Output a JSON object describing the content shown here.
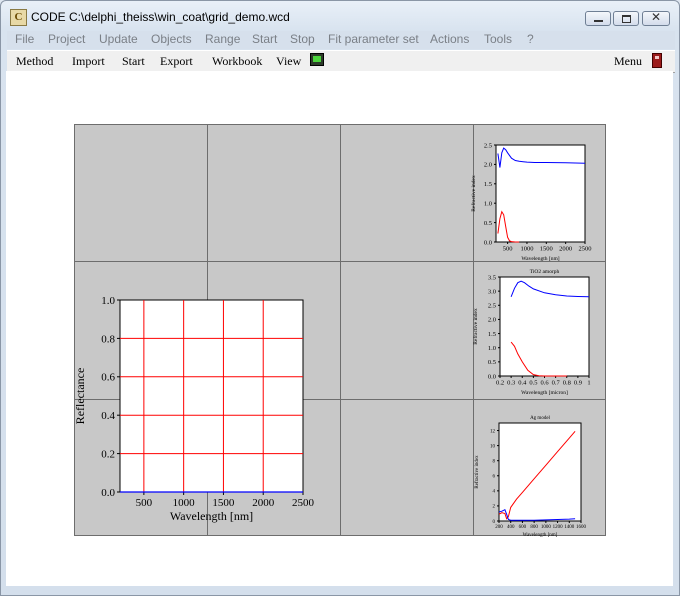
{
  "window": {
    "title": "CODE C:\\delphi_theiss\\win_coat\\grid_demo.wcd"
  },
  "menubar": [
    "File",
    "Project",
    "Update",
    "Objects",
    "Range",
    "Start",
    "Stop",
    "Fit parameter set",
    "Actions",
    "Tools",
    "?"
  ],
  "toolbar": {
    "items": [
      "Method",
      "Import",
      "Start",
      "Export",
      "Workbook",
      "View"
    ],
    "menu_label": "Menu"
  },
  "colors": {
    "blue_series": "#0000ff",
    "red_series": "#ff0000",
    "grid_bg": "#c8c8c8"
  },
  "chart_data": [
    {
      "type": "line",
      "title": "",
      "xlabel": "Wavelength [nm]",
      "ylabel": "Refractive index",
      "xlim": [
        200,
        2500
      ],
      "ylim": [
        0,
        2.5
      ],
      "xticks": [
        500,
        1000,
        1500,
        2000,
        2500
      ],
      "yticks": [
        0.0,
        0.5,
        1.0,
        1.5,
        2.0,
        2.5
      ],
      "series": [
        {
          "color": "blue",
          "x": [
            250,
            300,
            350,
            400,
            450,
            500,
            600,
            700,
            800,
            900,
            1000,
            1200,
            1500,
            2000,
            2500
          ],
          "y": [
            2.28,
            1.92,
            2.3,
            2.42,
            2.38,
            2.3,
            2.16,
            2.1,
            2.08,
            2.07,
            2.06,
            2.05,
            2.05,
            2.04,
            2.03
          ]
        },
        {
          "color": "red",
          "x": [
            250,
            300,
            350,
            400,
            450,
            500,
            550,
            600,
            700,
            800
          ],
          "y": [
            0.22,
            0.6,
            0.78,
            0.7,
            0.4,
            0.12,
            0.03,
            0.01,
            0.0,
            0.0
          ]
        }
      ]
    },
    {
      "type": "line",
      "title": "TiO2 amorph",
      "xlabel": "Wavelength [micron]",
      "ylabel": "Refractive index",
      "xlim": [
        0.2,
        1.0
      ],
      "ylim": [
        0,
        3.5
      ],
      "xticks": [
        0.2,
        0.3,
        0.4,
        0.5,
        0.6,
        0.7,
        0.8,
        0.9,
        1.0
      ],
      "yticks": [
        0.0,
        0.5,
        1.0,
        1.5,
        2.0,
        2.5,
        3.0,
        3.5
      ],
      "series": [
        {
          "color": "blue",
          "x": [
            0.3,
            0.33,
            0.36,
            0.39,
            0.42,
            0.46,
            0.5,
            0.6,
            0.7,
            0.8,
            0.9,
            1.0
          ],
          "y": [
            2.8,
            3.1,
            3.3,
            3.35,
            3.3,
            3.18,
            3.08,
            2.94,
            2.87,
            2.83,
            2.81,
            2.8
          ]
        },
        {
          "color": "red",
          "x": [
            0.3,
            0.33,
            0.36,
            0.4,
            0.45,
            0.5,
            0.55,
            0.6,
            0.7,
            0.8
          ],
          "y": [
            1.2,
            1.05,
            0.78,
            0.5,
            0.2,
            0.05,
            0.01,
            0.0,
            0.0,
            0.0
          ]
        }
      ]
    },
    {
      "type": "line",
      "title": "Ag model",
      "xlabel": "Wavelength [nm]",
      "ylabel": "Refractive index",
      "xlim": [
        200,
        1600
      ],
      "ylim": [
        0,
        13
      ],
      "xticks": [
        200,
        400,
        600,
        800,
        1000,
        1200,
        1400,
        1600
      ],
      "yticks": [
        0,
        2,
        4,
        6,
        8,
        10,
        12
      ],
      "series": [
        {
          "color": "red",
          "x": [
            200,
            250,
            300,
            330,
            360,
            400,
            500,
            600,
            800,
            1000,
            1200,
            1400,
            1500
          ],
          "y": [
            0.9,
            1.1,
            1.0,
            0.3,
            0.6,
            1.8,
            2.9,
            3.8,
            5.6,
            7.4,
            9.2,
            11.0,
            11.9
          ]
        },
        {
          "color": "blue",
          "x": [
            200,
            250,
            300,
            330,
            360,
            400,
            500,
            600,
            800,
            1000,
            1200,
            1400,
            1500
          ],
          "y": [
            1.2,
            1.3,
            1.5,
            0.9,
            0.2,
            0.1,
            0.1,
            0.1,
            0.1,
            0.15,
            0.2,
            0.25,
            0.3
          ]
        }
      ]
    },
    {
      "type": "line",
      "title": "",
      "xlabel": "Wavelength [nm]",
      "ylabel": "Reflectance",
      "xlim": [
        200,
        2500
      ],
      "ylim": [
        0,
        1.0
      ],
      "xticks": [
        500,
        1000,
        1500,
        2000,
        2500
      ],
      "yticks": [
        0.0,
        0.2,
        0.4,
        0.6,
        0.8,
        1.0
      ],
      "grid": true,
      "series": [
        {
          "color": "blue",
          "x": [
            200,
            2500
          ],
          "y": [
            0.0,
            0.0
          ]
        }
      ]
    }
  ]
}
